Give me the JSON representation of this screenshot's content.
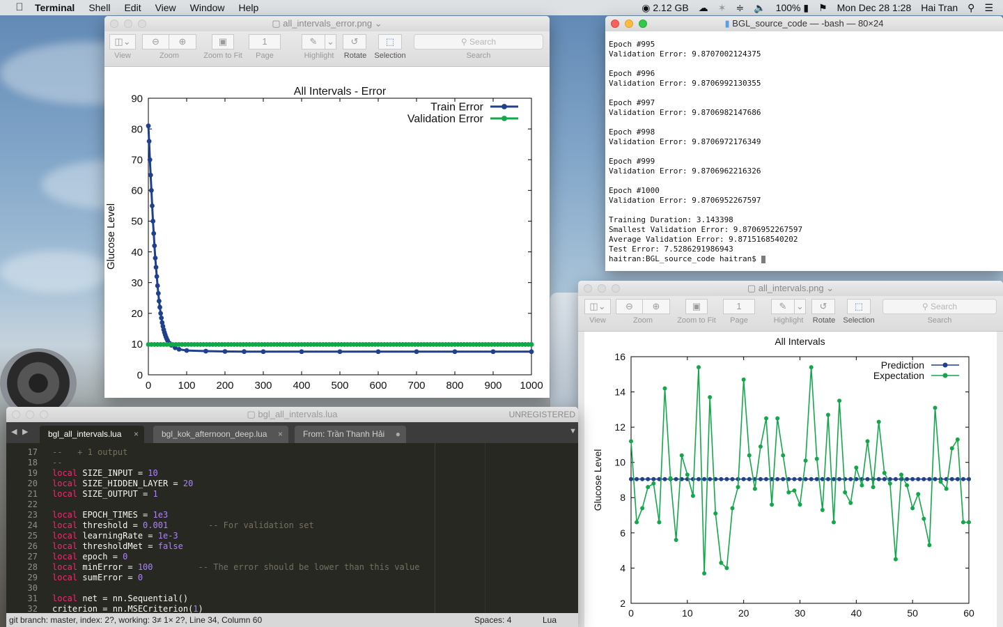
{
  "menubar": {
    "app": "Terminal",
    "items": [
      "Shell",
      "Edit",
      "View",
      "Window",
      "Help"
    ],
    "status": {
      "memory": "2.12 GB",
      "battery": "100%",
      "datetime": "Mon Dec 28  1:28",
      "user": "Hai Tran"
    }
  },
  "preview_error": {
    "title": "all_intervals_error.png",
    "toolbar": {
      "view": "View",
      "zoom": "Zoom",
      "zoom_fit": "Zoom to Fit",
      "page_value": "1",
      "page": "Page",
      "highlight": "Highlight",
      "rotate": "Rotate",
      "selection": "Selection",
      "search_placeholder": "Search",
      "search": "Search"
    }
  },
  "terminal": {
    "title": "BGL_source_code — -bash — 80×24",
    "lines": [
      "Epoch #995",
      "Validation Error: 9.8707002124375",
      "",
      "Epoch #996",
      "Validation Error: 9.8706992130355",
      "",
      "Epoch #997",
      "Validation Error: 9.8706982147686",
      "",
      "Epoch #998",
      "Validation Error: 9.8706972176349",
      "",
      "Epoch #999",
      "Validation Error: 9.8706962216326",
      "",
      "Epoch #1000",
      "Validation Error: 9.8706952267597",
      "",
      "Training Duration: 3.143398",
      "Smallest Validation Error: 9.8706952267597",
      "Average Validation Error: 9.8715168540202",
      "Test Error: 7.5286291986943"
    ],
    "prompt": "haitran:BGL_source_code haitran$ "
  },
  "preview_intervals": {
    "title": "all_intervals.png",
    "toolbar": {
      "view": "View",
      "zoom": "Zoom",
      "zoom_fit": "Zoom to Fit",
      "page_value": "1",
      "page": "Page",
      "highlight": "Highlight",
      "rotate": "Rotate",
      "selection": "Selection",
      "search_placeholder": "Search",
      "search": "Search"
    }
  },
  "sublime": {
    "title": "bgl_all_intervals.lua",
    "unregistered": "UNREGISTERED",
    "tabs": [
      {
        "label": "bgl_all_intervals.lua",
        "close": "×"
      },
      {
        "label": "bgl_kok_afternoon_deep.lua",
        "close": "×"
      },
      {
        "label": "From: Trần Thanh Hải",
        "close": "●"
      }
    ],
    "line_numbers": [
      "17",
      "18",
      "19",
      "20",
      "21",
      "22",
      "23",
      "24",
      "25",
      "26",
      "27",
      "28",
      "29",
      "30",
      "31",
      "32"
    ],
    "code": [
      [
        {
          "t": "cm",
          "v": "--   + 1 output"
        }
      ],
      [
        {
          "t": "cm",
          "v": "--"
        }
      ],
      [
        {
          "t": "kw",
          "v": "local"
        },
        {
          "t": "",
          "v": " SIZE_INPUT = "
        },
        {
          "t": "num",
          "v": "10"
        }
      ],
      [
        {
          "t": "kw",
          "v": "local"
        },
        {
          "t": "",
          "v": " SIZE_HIDDEN_LAYER = "
        },
        {
          "t": "num",
          "v": "20"
        }
      ],
      [
        {
          "t": "kw",
          "v": "local"
        },
        {
          "t": "",
          "v": " SIZE_OUTPUT = "
        },
        {
          "t": "num",
          "v": "1"
        }
      ],
      [],
      [
        {
          "t": "kw",
          "v": "local"
        },
        {
          "t": "",
          "v": " EPOCH_TIMES = "
        },
        {
          "t": "num",
          "v": "1e3"
        }
      ],
      [
        {
          "t": "kw",
          "v": "local"
        },
        {
          "t": "",
          "v": " threshold = "
        },
        {
          "t": "num",
          "v": "0.001"
        },
        {
          "t": "",
          "v": "        "
        },
        {
          "t": "cm",
          "v": "-- For validation set"
        }
      ],
      [
        {
          "t": "kw",
          "v": "local"
        },
        {
          "t": "",
          "v": " learningRate = "
        },
        {
          "t": "num",
          "v": "1e-3"
        }
      ],
      [
        {
          "t": "kw",
          "v": "local"
        },
        {
          "t": "",
          "v": " thresholdMet = "
        },
        {
          "t": "num",
          "v": "false"
        }
      ],
      [
        {
          "t": "kw",
          "v": "local"
        },
        {
          "t": "",
          "v": " epoch = "
        },
        {
          "t": "num",
          "v": "0"
        }
      ],
      [
        {
          "t": "kw",
          "v": "local"
        },
        {
          "t": "",
          "v": " minError = "
        },
        {
          "t": "num",
          "v": "100"
        },
        {
          "t": "",
          "v": "         "
        },
        {
          "t": "cm",
          "v": "-- The error should be lower than this value"
        }
      ],
      [
        {
          "t": "kw",
          "v": "local"
        },
        {
          "t": "",
          "v": " sumError = "
        },
        {
          "t": "num",
          "v": "0"
        }
      ],
      [],
      [
        {
          "t": "kw",
          "v": "local"
        },
        {
          "t": "",
          "v": " net = nn.Sequential()"
        }
      ],
      [
        {
          "t": "",
          "v": "criterion = nn.MSECriterion("
        },
        {
          "t": "num",
          "v": "1"
        },
        {
          "t": "",
          "v": ")"
        }
      ]
    ],
    "status": {
      "left": "git branch: master, index: 2?, working: 3≠ 1× 2?, Line 34, Column 60",
      "spaces": "Spaces: 4",
      "lang": "Lua"
    }
  },
  "chart_data": [
    {
      "type": "line",
      "title": "All Intervals - Error",
      "xlabel": "",
      "ylabel": "Glucose Level",
      "xlim": [
        0,
        1000
      ],
      "ylim": [
        0,
        90
      ],
      "xticks": [
        0,
        100,
        200,
        300,
        400,
        500,
        600,
        700,
        800,
        900,
        1000
      ],
      "yticks": [
        0,
        10,
        20,
        30,
        40,
        50,
        60,
        70,
        80,
        90
      ],
      "legend": "top-right",
      "series": [
        {
          "name": "Train Error",
          "color": "#1f3f8f",
          "x": [
            0,
            2,
            4,
            6,
            8,
            10,
            12,
            14,
            16,
            18,
            20,
            22,
            24,
            26,
            28,
            30,
            32,
            34,
            36,
            38,
            40,
            42,
            44,
            46,
            48,
            50,
            55,
            60,
            70,
            80,
            100,
            150,
            200,
            250,
            300,
            400,
            500,
            600,
            700,
            800,
            900,
            1000
          ],
          "y": [
            81,
            76,
            70,
            65,
            60,
            55,
            50,
            46,
            42,
            38,
            35,
            32,
            29,
            26.5,
            24,
            22,
            20,
            18.5,
            17,
            15.8,
            14.7,
            13.8,
            13,
            12.3,
            11.7,
            11.2,
            10.3,
            9.6,
            8.8,
            8.3,
            7.9,
            7.7,
            7.6,
            7.55,
            7.53,
            7.53,
            7.53,
            7.53,
            7.53,
            7.53,
            7.53,
            7.53
          ]
        },
        {
          "name": "Validation Error",
          "color": "#12a84a",
          "x": [
            0,
            1000
          ],
          "y": [
            9.87,
            9.87
          ]
        }
      ]
    },
    {
      "type": "line",
      "title": "All Intervals",
      "xlabel": "",
      "ylabel": "Glucose Level",
      "xlim": [
        0,
        60
      ],
      "ylim": [
        2,
        16
      ],
      "xticks": [
        0,
        10,
        20,
        30,
        40,
        50,
        60
      ],
      "yticks": [
        2,
        4,
        6,
        8,
        10,
        12,
        14,
        16
      ],
      "legend": "top-right",
      "series": [
        {
          "name": "Prediction",
          "color": "#1f3f8f",
          "x": [
            0,
            1,
            2,
            3,
            4,
            5,
            6,
            7,
            8,
            9,
            10,
            11,
            12,
            13,
            14,
            15,
            16,
            17,
            18,
            19,
            20,
            21,
            22,
            23,
            24,
            25,
            26,
            27,
            28,
            29,
            30,
            31,
            32,
            33,
            34,
            35,
            36,
            37,
            38,
            39,
            40,
            41,
            42,
            43,
            44,
            45,
            46,
            47,
            48,
            49,
            50,
            51,
            52,
            53,
            54,
            55,
            56,
            57,
            58,
            59,
            60
          ],
          "y": [
            9.05,
            9.05,
            9.05,
            9.05,
            9.05,
            9.05,
            9.05,
            9.05,
            9.05,
            9.05,
            9.05,
            9.05,
            9.05,
            9.05,
            9.05,
            9.05,
            9.05,
            9.05,
            9.05,
            9.05,
            9.05,
            9.05,
            9.05,
            9.05,
            9.05,
            9.05,
            9.05,
            9.05,
            9.05,
            9.05,
            9.05,
            9.05,
            9.05,
            9.05,
            9.05,
            9.05,
            9.05,
            9.05,
            9.05,
            9.05,
            9.05,
            9.05,
            9.05,
            9.05,
            9.05,
            9.05,
            9.05,
            9.05,
            9.05,
            9.05,
            9.05,
            9.05,
            9.05,
            9.05,
            9.05,
            9.05,
            9.05,
            9.05,
            9.05,
            9.05,
            9.05
          ]
        },
        {
          "name": "Expectation",
          "color": "#12a84a",
          "x": [
            0,
            1,
            2,
            3,
            4,
            5,
            6,
            7,
            8,
            9,
            10,
            11,
            12,
            13,
            14,
            15,
            16,
            17,
            18,
            19,
            20,
            21,
            22,
            23,
            24,
            25,
            26,
            27,
            28,
            29,
            30,
            31,
            32,
            33,
            34,
            35,
            36,
            37,
            38,
            39,
            40,
            41,
            42,
            43,
            44,
            45,
            46,
            47,
            48,
            49,
            50,
            51,
            52,
            53,
            54,
            55,
            56,
            57,
            58,
            59,
            60
          ],
          "y": [
            11.2,
            6.6,
            7.4,
            8.6,
            8.8,
            6.6,
            14.2,
            9.1,
            5.6,
            10.4,
            9.3,
            8.1,
            15.4,
            3.7,
            13.7,
            7.1,
            4.3,
            4.0,
            7.4,
            8.6,
            14.7,
            10.4,
            8.5,
            10.9,
            12.5,
            7.6,
            12.5,
            10.4,
            8.3,
            8.4,
            7.6,
            10.1,
            15.4,
            10.2,
            7.3,
            12.7,
            6.6,
            13.5,
            8.3,
            7.7,
            9.7,
            8.7,
            11.2,
            8.6,
            12.3,
            9.4,
            8.8,
            4.5,
            9.3,
            8.7,
            7.4,
            8.2,
            6.8,
            5.3,
            13.1,
            8.9,
            8.5,
            10.8,
            11.3,
            6.6,
            6.6
          ]
        }
      ]
    }
  ]
}
